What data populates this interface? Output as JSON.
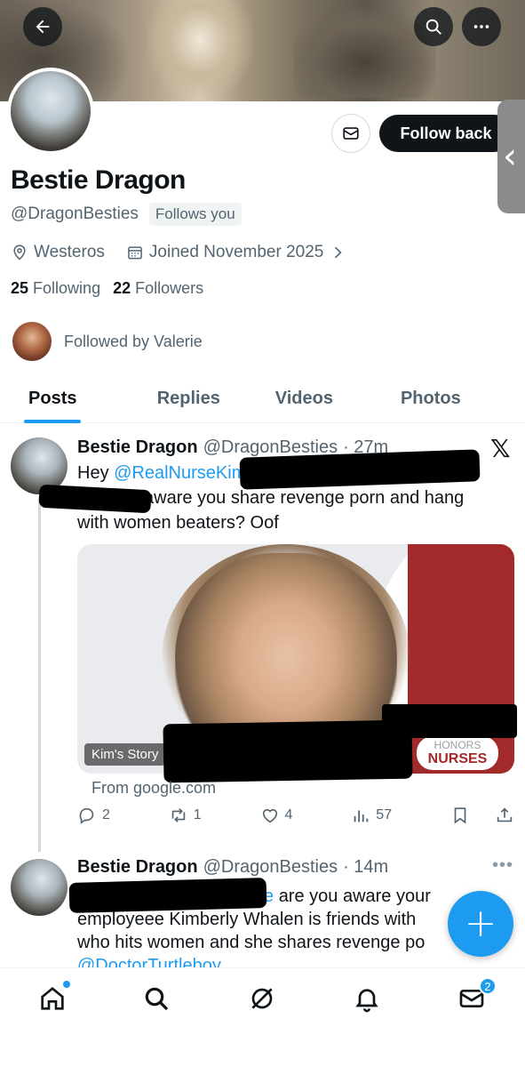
{
  "profile": {
    "display_name": "Bestie Dragon",
    "handle": "@DragonBesties",
    "follows_you_label": "Follows you",
    "location": "Westeros",
    "joined": "Joined November 2025",
    "following_count": "25",
    "following_label": "Following",
    "followers_count": "22",
    "followers_label": "Followers",
    "followed_by": "Followed by Valerie",
    "follow_button_label": "Follow back"
  },
  "tabs": [
    {
      "label": "Posts",
      "active": true
    },
    {
      "label": "Replies",
      "active": false
    },
    {
      "label": "Videos",
      "active": false
    },
    {
      "label": "Photos",
      "active": false
    }
  ],
  "posts": [
    {
      "name": "Bestie Dragon",
      "handle": "@DragonBesties",
      "time": "· 27m",
      "text_prefix": "Hey ",
      "mention": "@RealNurseKim",
      "text_line2": "aware you share revenge porn and hang",
      "text_line3": "with women beaters? Oof",
      "card": {
        "overlay_label": "Kim's Story",
        "badge_top": "HONORS",
        "badge_bottom": "NURSES",
        "source": "From google.com"
      },
      "stats": {
        "replies": "2",
        "reposts": "1",
        "likes": "4",
        "views": "57"
      }
    },
    {
      "name": "Bestie Dragon",
      "handle": "@DragonBesties",
      "time": "· 14m",
      "link_fragment": "e",
      "text_line1": "are you aware your",
      "text_line2": "employeee Kimberly Whalen is friends with",
      "text_line3": "who hits women and she shares revenge  po",
      "text_line4": "@DoctorTurtleboy"
    }
  ],
  "bottom_nav": {
    "messages_badge": "2"
  },
  "icons": [
    "back-arrow-icon",
    "search-icon",
    "more-icon",
    "mail-icon",
    "location-icon",
    "calendar-icon",
    "chevron-right-icon",
    "x-logo-icon",
    "reply-icon",
    "repost-icon",
    "like-icon",
    "views-icon",
    "bookmark-icon",
    "share-icon",
    "plus-icon",
    "home-icon",
    "grok-icon",
    "bell-icon",
    "envelope-icon"
  ],
  "colors": {
    "accent": "#1d9bf0",
    "text": "#0f1419",
    "muted": "#536471"
  }
}
